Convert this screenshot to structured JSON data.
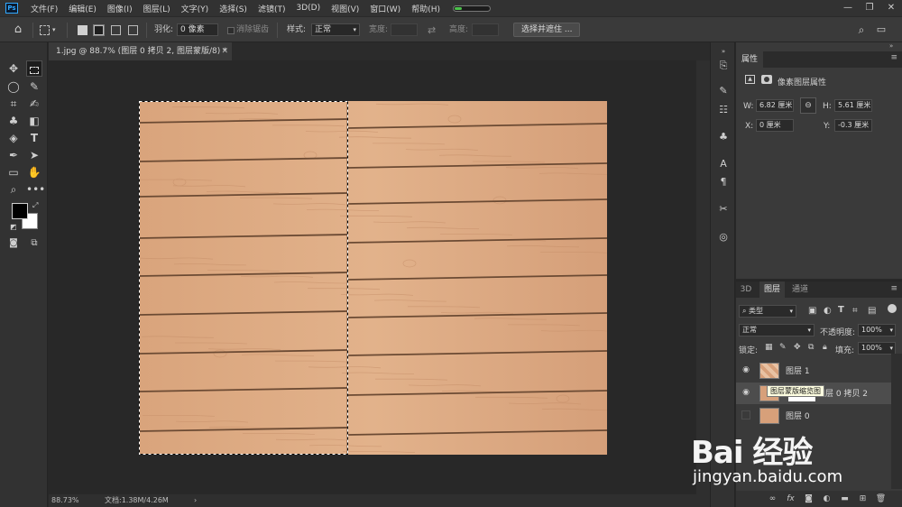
{
  "app": {
    "logo": "Ps"
  },
  "menu": [
    "文件(F)",
    "编辑(E)",
    "图像(I)",
    "图层(L)",
    "文字(Y)",
    "选择(S)",
    "滤镜(T)",
    "3D(D)",
    "视图(V)",
    "窗口(W)",
    "帮助(H)"
  ],
  "window_controls": [
    "—",
    "❐",
    "✕"
  ],
  "options": {
    "feather_label": "羽化:",
    "feather_value": "0 像素",
    "antialias_label": "消除锯齿",
    "style_label": "样式:",
    "style_value": "正常",
    "width_label": "宽度:",
    "height_label": "高度:",
    "select_mask_button": "选择并遮住 ..."
  },
  "document_tab": {
    "title": "1.jpg @ 88.7% (图层 0 拷贝 2, 图层蒙版/8) *",
    "close": "✕"
  },
  "status": {
    "zoom": "88.73%",
    "doc": "文档:1.38M/4.26M",
    "arrow": "›"
  },
  "properties": {
    "tab": "属性",
    "title": "像素图层属性",
    "w_label": "W:",
    "w_value": "6.82 厘米",
    "h_label": "H:",
    "h_value": "5.61 厘米",
    "x_label": "X:",
    "x_value": "0 厘米",
    "y_label": "Y:",
    "y_value": "-0.3 厘米",
    "link_icon": "link-icon"
  },
  "layers_panel": {
    "tabs": [
      "3D",
      "图层",
      "通道"
    ],
    "active_tab": "图层",
    "filter_label": "类型",
    "blend_mode": "正常",
    "opacity_label": "不透明度:",
    "opacity_value": "100%",
    "lock_label": "锁定:",
    "fill_label": "填充:",
    "fill_value": "100%",
    "layers": [
      {
        "name": "图层 1",
        "visible": true,
        "selected": false
      },
      {
        "name": "图层 0 拷贝 2",
        "visible": true,
        "selected": true
      },
      {
        "name": "图层 0",
        "visible": false,
        "selected": false
      }
    ],
    "tooltip": "图层蒙版缩览图"
  },
  "watermark": {
    "logo": "Bai 经验",
    "url": "jingyan.baidu.com"
  },
  "colors": {
    "accent": "#31a8ff",
    "wood": "#d8a57e",
    "plank_line": "#6b4a33"
  }
}
